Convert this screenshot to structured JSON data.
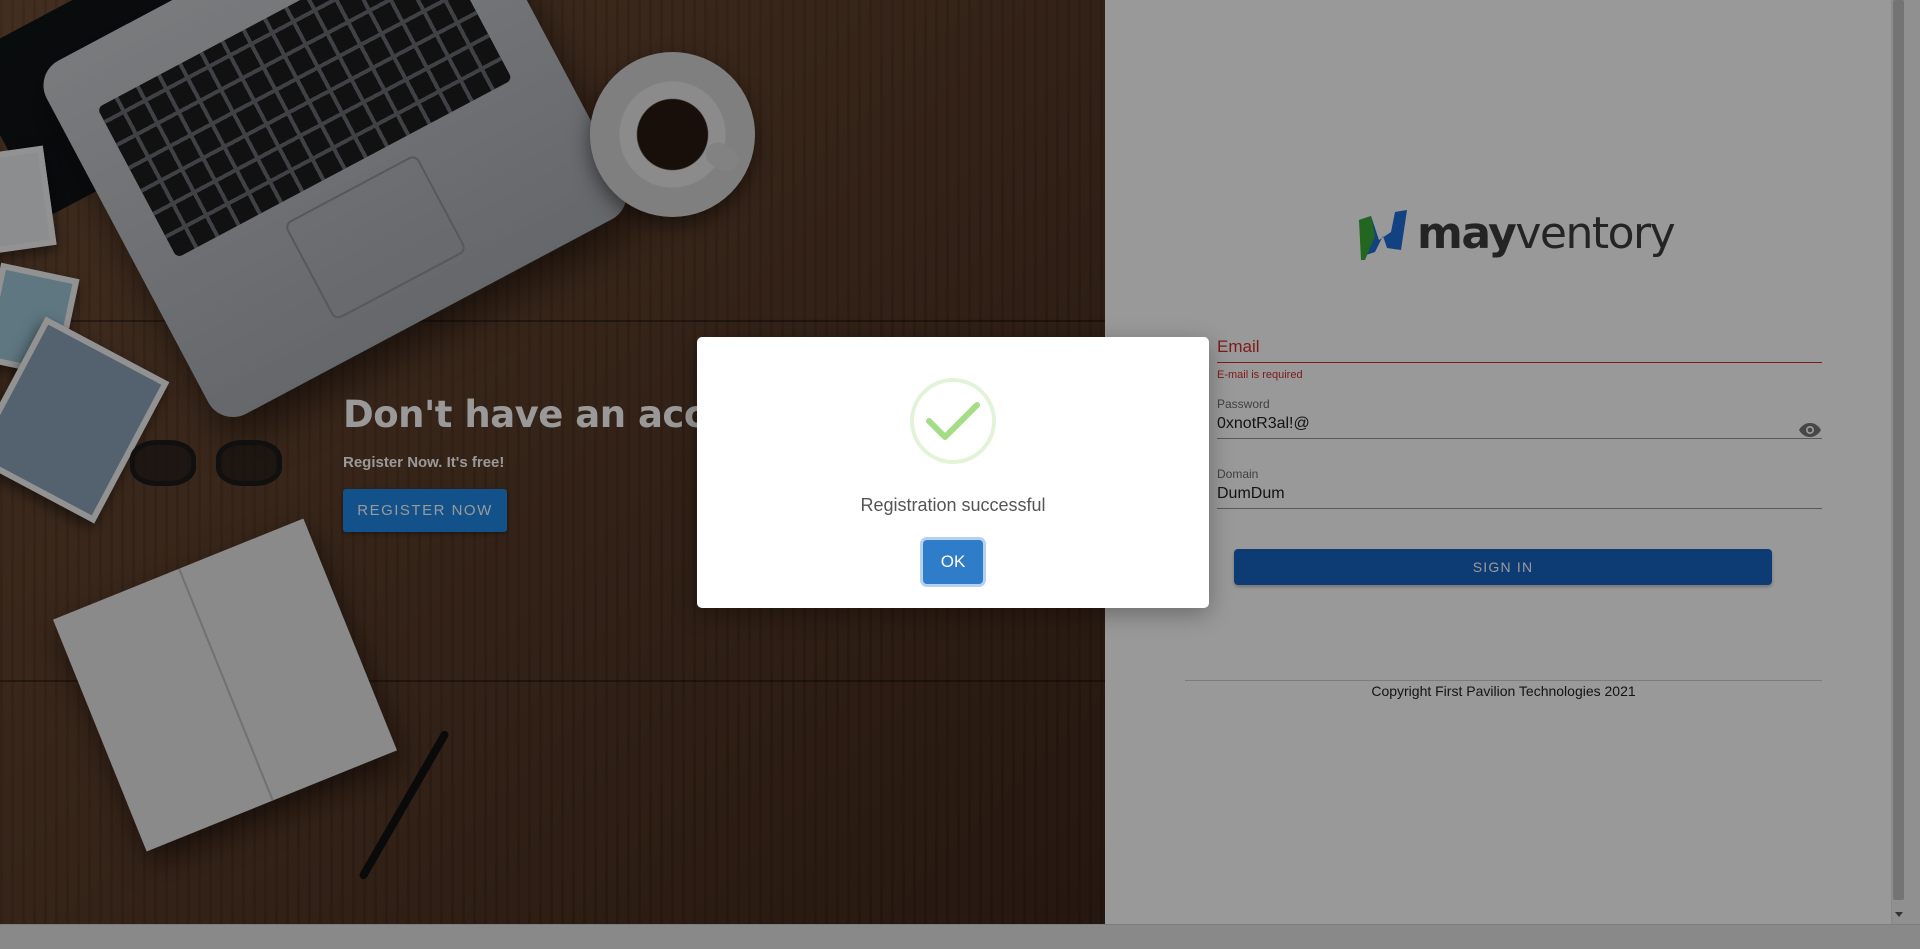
{
  "hero": {
    "title": "Don't have an account?",
    "subtitle": "Register Now. It's free!",
    "register_label": "REGISTER NOW"
  },
  "brand": {
    "word_bold": "may",
    "word_light": "ventory",
    "mark_colors": [
      "#3aaa35",
      "#1e6fd9"
    ]
  },
  "form": {
    "email": {
      "placeholder": "Email",
      "value": "",
      "error": "E-mail is required"
    },
    "password": {
      "label": "Password",
      "value": "0xnotR3al!@",
      "toggle_icon": "eye-icon"
    },
    "domain": {
      "label": "Domain",
      "value": "DumDum"
    },
    "signin_label": "SIGN IN"
  },
  "footer": {
    "copyright": "Copyright First Pavilion Technologies 2021"
  },
  "modal": {
    "icon": "success-check-icon",
    "message": "Registration successful",
    "ok_label": "OK",
    "colors": {
      "check": "#a5dc86",
      "ring": "#e3f3d8",
      "button": "#2f7cc9"
    }
  },
  "colors": {
    "primary": "#1565c0",
    "error": "#d32f2f"
  }
}
